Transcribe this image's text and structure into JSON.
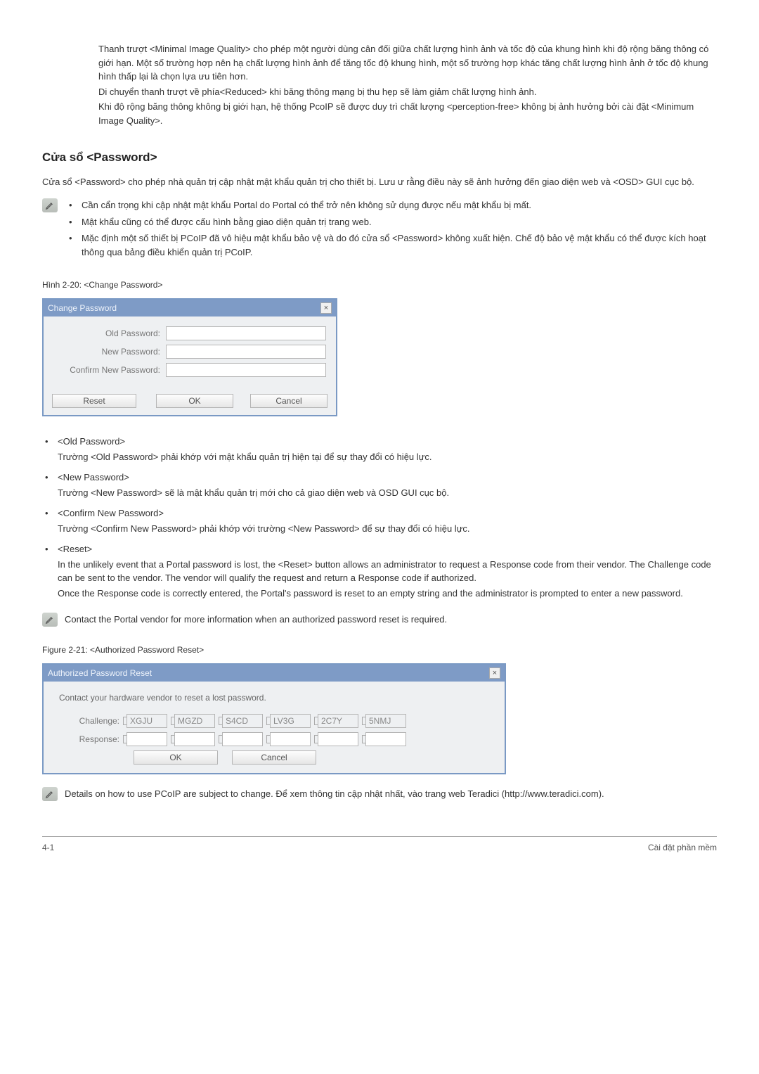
{
  "intro": {
    "p1": "Thanh trượt <Minimal Image Quality> cho phép một người dùng cân đối giữa chất lượng hình ảnh và tốc độ của khung hình khi độ rộng băng thông có giới hạn. Một số trường hợp nên hạ chất lượng hình ảnh để tăng tốc độ khung hình, một số trường hợp khác tăng chất lượng hình ảnh ở tốc độ khung hình thấp lại là chọn lựa ưu tiên hơn.",
    "p2": "Di chuyển thanh trượt về phía<Reduced> khi băng thông mạng bị thu hẹp sẽ làm giảm chất lượng hình ảnh.",
    "p3": "Khi độ rộng băng thông không bị giới hạn, hệ thống PcoIP sẽ được duy trì chất lượng <perception-free> không bị ảnh hưởng bởi cài đặt <Minimum Image Quality>."
  },
  "section": {
    "heading": "Cửa sổ <Password>",
    "desc": "Cửa sổ <Password> cho phép nhà quản trị cập nhật mật khẩu quản trị cho thiết bị. Lưu ư rằng điều này sẽ ảnh hưởng đến giao diện web và <OSD> GUI cục bộ."
  },
  "note1": {
    "items": [
      "Cần cẩn trọng khi cập nhật mật khẩu Portal do Portal có thể trở nên không sử dụng được nếu mật khẩu bị mất.",
      "Mật khẩu cũng có thể được cấu hình bằng giao diện quản trị trang web.",
      "Mặc định một số thiết bị PCoIP đã vô hiệu mật khẩu bảo vệ và do đó cửa sổ <Password> không xuất hiện. Chế độ bảo vệ mật khẩu có thể được kích hoạt thông qua bảng điều khiển quản trị PCoIP."
    ]
  },
  "fig1": {
    "caption": "Hình 2-20: <Change Password>"
  },
  "dialog1": {
    "title": "Change Password",
    "old": "Old Password:",
    "new": "New Password:",
    "confirm": "Confirm New Password:",
    "reset": "Reset",
    "ok": "OK",
    "cancel": "Cancel"
  },
  "defs": [
    {
      "term": "<Old Password>",
      "lines": [
        "Trường <Old Password> phải khớp với mật khẩu quản trị hiện tại để sự thay đổi có hiệu lực."
      ]
    },
    {
      "term": "<New Password>",
      "lines": [
        "Trường <New Password> sẽ là mật khẩu quản trị mới cho cả giao diện web và OSD GUI cục bộ."
      ]
    },
    {
      "term": "<Confirm New Password>",
      "lines": [
        "Trường <Confirm New Password> phải khớp với trường <New Password> để sự thay đổi có hiệu lực."
      ]
    },
    {
      "term": "<Reset>",
      "lines": [
        "In the unlikely event that a Portal password is lost, the <Reset> button allows an administrator to request a Response code from their vendor. The Challenge code can be sent to the vendor. The vendor will qualify the request and return a Response code if authorized.",
        "Once the Response code is correctly entered, the Portal's password is reset to an empty string and the administrator is prompted to enter a new password."
      ]
    }
  ],
  "note2": "Contact the Portal vendor for more information when an authorized password reset is required.",
  "fig2": {
    "caption": "Figure 2-21: <Authorized Password Reset>"
  },
  "dialog2": {
    "title": "Authorized Password Reset",
    "instruction": "Contact your hardware vendor to reset a lost password.",
    "challenge_label": "Challenge:",
    "response_label": "Response:",
    "challenge": [
      "XGJU",
      "MGZD",
      "S4CD",
      "LV3G",
      "2C7Y",
      "5NMJ"
    ],
    "ok": "OK",
    "cancel": "Cancel"
  },
  "note3": "Details on how to use PCoIP are subject to change. Để xem thông tin cập nhật nhất, vào trang web Teradici (http://www.teradici.com).",
  "footer": {
    "left": "4-1",
    "right": "Cài đặt phần mềm"
  }
}
